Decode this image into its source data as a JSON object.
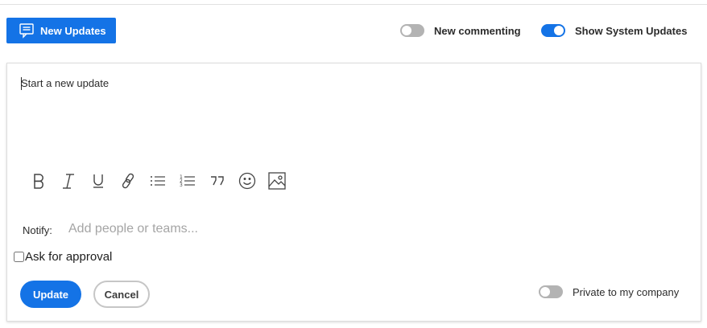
{
  "header": {
    "new_updates_label": "New Updates",
    "new_commenting_label": "New commenting",
    "new_commenting_on": false,
    "show_system_updates_label": "Show System Updates",
    "show_system_updates_on": true
  },
  "editor": {
    "placeholder": "Start a new update",
    "toolbar": [
      "bold-icon",
      "italic-icon",
      "underline-icon",
      "link-icon",
      "bullet-list-icon",
      "numbered-list-icon",
      "quote-icon",
      "emoji-icon",
      "image-icon"
    ]
  },
  "notify": {
    "label": "Notify:",
    "placeholder": "Add people or teams..."
  },
  "approval": {
    "label": "Ask for approval",
    "checked": false
  },
  "actions": {
    "update_label": "Update",
    "cancel_label": "Cancel",
    "private_label": "Private to my company",
    "private_on": false
  },
  "colors": {
    "accent": "#1473e6",
    "toggle_off": "#b3b3b3",
    "border": "#dedede"
  }
}
